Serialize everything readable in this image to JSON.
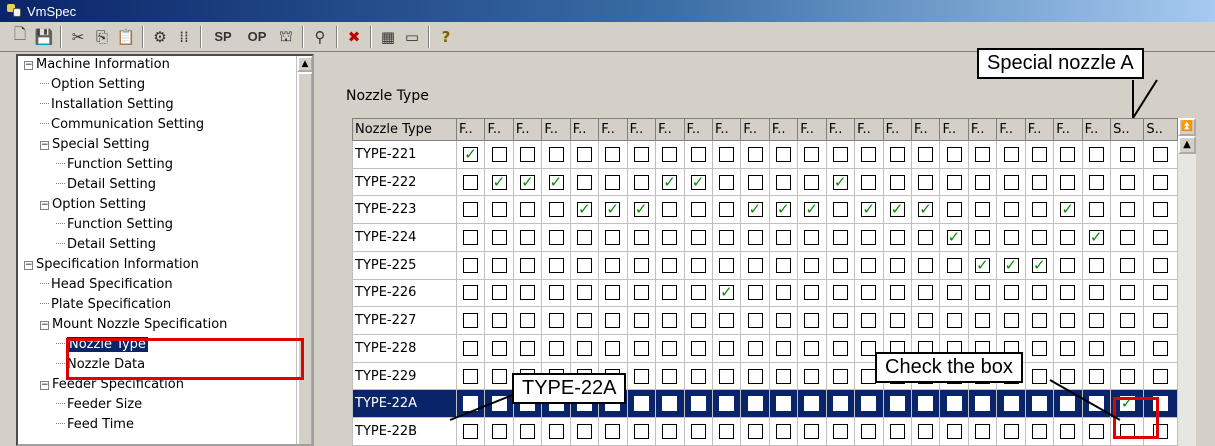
{
  "window": {
    "title": "VmSpec"
  },
  "toolbar": {
    "items": [
      {
        "icon": "new-document-icon"
      },
      {
        "icon": "save-icon"
      },
      {
        "icon": "cut-icon"
      },
      {
        "icon": "copy-icon"
      },
      {
        "icon": "paste-icon"
      },
      {
        "icon": "gear-icon"
      },
      {
        "icon": "dots-icon"
      },
      {
        "label": "SP"
      },
      {
        "label": "OP"
      },
      {
        "icon": "machine-icon"
      },
      {
        "icon": "nozzle-icon"
      },
      {
        "icon": "tool-x-icon"
      },
      {
        "icon": "grid-icon"
      },
      {
        "icon": "tray-icon"
      },
      {
        "icon": "help-icon"
      }
    ]
  },
  "tree": {
    "items": [
      {
        "label": "Machine Information",
        "level": 0,
        "expander": "-"
      },
      {
        "label": "Option Setting",
        "level": 1
      },
      {
        "label": "Installation Setting",
        "level": 1
      },
      {
        "label": "Communication Setting",
        "level": 1
      },
      {
        "label": "Special Setting",
        "level": 1,
        "expander": "-"
      },
      {
        "label": "Function Setting",
        "level": 2
      },
      {
        "label": "Detail Setting",
        "level": 2
      },
      {
        "label": "Option Setting",
        "level": 1,
        "expander": "-"
      },
      {
        "label": "Function Setting",
        "level": 2
      },
      {
        "label": "Detail Setting",
        "level": 2
      },
      {
        "label": "Specification Information",
        "level": 0,
        "expander": "-"
      },
      {
        "label": "Head Specification",
        "level": 1
      },
      {
        "label": "Plate Specification",
        "level": 1
      },
      {
        "label": "Mount Nozzle Specification",
        "level": 1,
        "expander": "-"
      },
      {
        "label": "Nozzle Type",
        "level": 2,
        "selected": true
      },
      {
        "label": "Nozzle Data",
        "level": 2
      },
      {
        "label": "Feeder Specification",
        "level": 1,
        "expander": "-"
      },
      {
        "label": "Feeder Size",
        "level": 2
      },
      {
        "label": "Feed Time",
        "level": 2
      }
    ]
  },
  "panel": {
    "heading": "Nozzle Type"
  },
  "grid": {
    "header_first": "Nozzle Type",
    "columns": [
      "F..",
      "F..",
      "F..",
      "F..",
      "F..",
      "F..",
      "F..",
      "F..",
      "F..",
      "F..",
      "F..",
      "F..",
      "F..",
      "F..",
      "F..",
      "F..",
      "F..",
      "F..",
      "F..",
      "F..",
      "F..",
      "F..",
      "F..",
      "S..",
      "S.."
    ],
    "rows": [
      {
        "label": "TYPE-221",
        "checked": [
          0
        ]
      },
      {
        "label": "TYPE-222",
        "checked": [
          1,
          2,
          3,
          7,
          8,
          13
        ]
      },
      {
        "label": "TYPE-223",
        "checked": [
          4,
          5,
          6,
          10,
          11,
          12,
          14,
          15,
          16,
          21
        ]
      },
      {
        "label": "TYPE-224",
        "checked": [
          17,
          22
        ]
      },
      {
        "label": "TYPE-225",
        "checked": [
          18,
          19,
          20
        ]
      },
      {
        "label": "TYPE-226",
        "checked": [
          9
        ]
      },
      {
        "label": "TYPE-227",
        "checked": []
      },
      {
        "label": "TYPE-228",
        "checked": []
      },
      {
        "label": "TYPE-229",
        "checked": []
      },
      {
        "label": "TYPE-22A",
        "checked": [
          23
        ],
        "selected": true
      },
      {
        "label": "TYPE-22B",
        "checked": []
      }
    ]
  },
  "callouts": {
    "special_nozzle": "Special nozzle A",
    "check_box": "Check the box",
    "type22a": "TYPE-22A"
  },
  "colors": {
    "highlight": "#0a246a",
    "annotation": "#e00000",
    "check": "#0a8a0a"
  }
}
